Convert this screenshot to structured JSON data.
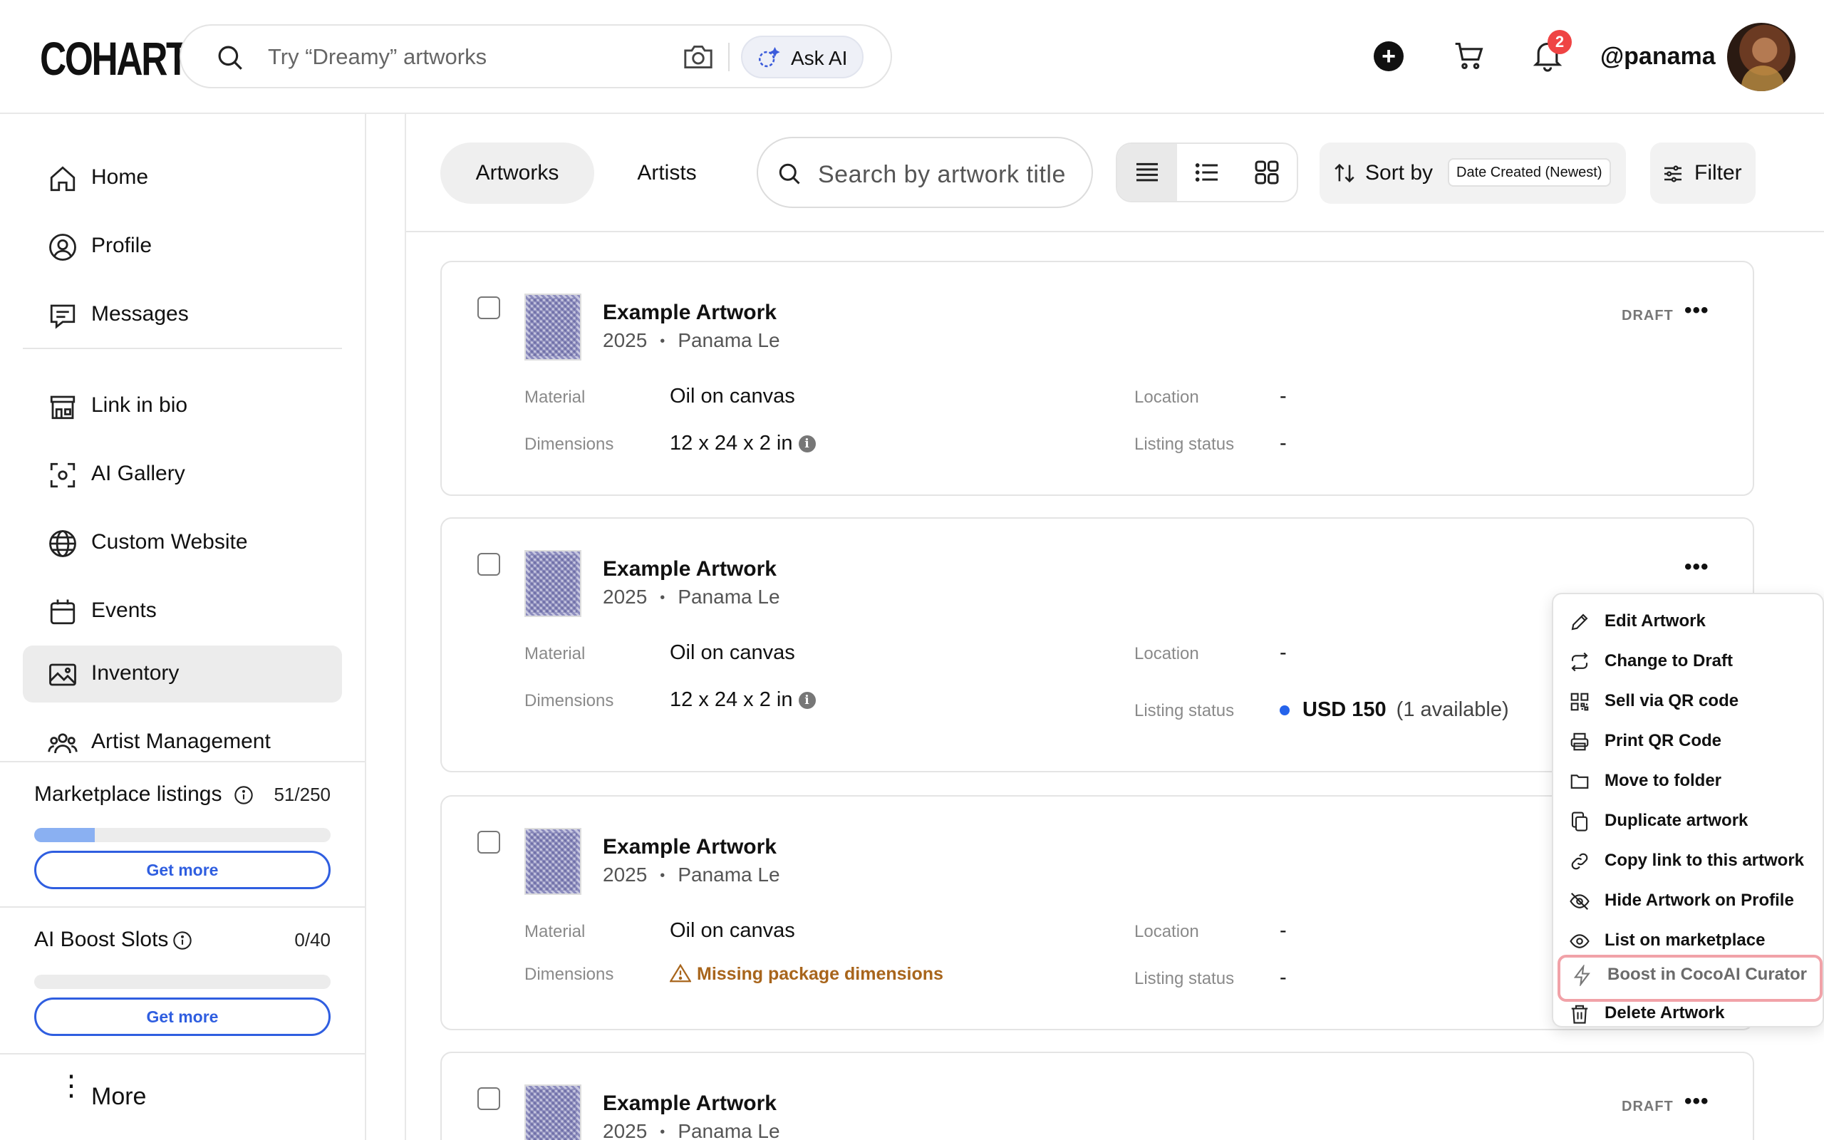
{
  "app": {
    "logo": "COHART",
    "search_placeholder": "Try “Dreamy” artworks",
    "ask_ai": "Ask AI",
    "notifications_count": "2",
    "username": "@panama"
  },
  "sidebar": {
    "items": [
      {
        "label": "Home",
        "icon": "home-icon"
      },
      {
        "label": "Profile",
        "icon": "profile-icon"
      },
      {
        "label": "Messages",
        "icon": "messages-icon"
      },
      {
        "label": "Link in bio",
        "icon": "storefront-icon"
      },
      {
        "label": "AI Gallery",
        "icon": "scan-icon"
      },
      {
        "label": "Custom Website",
        "icon": "globe-icon"
      },
      {
        "label": "Events",
        "icon": "calendar-icon"
      },
      {
        "label": "Inventory",
        "icon": "image-icon",
        "active": true
      },
      {
        "label": "Artist Management",
        "icon": "people-icon"
      }
    ],
    "marketplace": {
      "title": "Marketplace listings",
      "count": "51/250",
      "fraction": 0.204,
      "button": "Get more"
    },
    "boost": {
      "title": "AI Boost Slots",
      "count": "0/40",
      "fraction": 0,
      "button": "Get more"
    },
    "more": "More"
  },
  "toolbar": {
    "tabs": [
      "Artworks",
      "Artists"
    ],
    "search_placeholder": "Search by artwork title",
    "sort_label": "Sort by",
    "sort_value": "Date Created (Newest)",
    "filter": "Filter"
  },
  "labels": {
    "material": "Material",
    "dimensions": "Dimensions",
    "location": "Location",
    "listing_status": "Listing status"
  },
  "artworks": [
    {
      "title": "Example Artwork",
      "year": "2025",
      "artist": "Panama Le",
      "badge": "DRAFT",
      "material": "Oil on canvas",
      "dimensions": "12 x 24 x 2 in",
      "location": "-",
      "listing_status": "-"
    },
    {
      "title": "Example Artwork",
      "year": "2025",
      "artist": "Panama Le",
      "badge": "",
      "material": "Oil on canvas",
      "dimensions": "12 x 24 x 2 in",
      "location": "-",
      "price": "USD 150",
      "availability": "(1 available)"
    },
    {
      "title": "Example Artwork",
      "year": "2025",
      "artist": "Panama Le",
      "badge": "",
      "material": "Oil on canvas",
      "dimensions_warning": "Missing package dimensions",
      "location": "-",
      "listing_status": "-"
    },
    {
      "title": "Example Artwork",
      "year": "2025",
      "artist": "Panama Le",
      "badge": "DRAFT"
    }
  ],
  "separator": "•",
  "menu": [
    {
      "label": "Edit Artwork",
      "icon": "pencil-icon"
    },
    {
      "label": "Change to Draft",
      "icon": "repeat-icon"
    },
    {
      "label": "Sell via QR code",
      "icon": "qr-code-icon"
    },
    {
      "label": "Print QR Code",
      "icon": "printer-icon"
    },
    {
      "label": "Move to folder",
      "icon": "folder-icon"
    },
    {
      "label": "Duplicate artwork",
      "icon": "duplicate-icon"
    },
    {
      "label": "Copy link to this artwork",
      "icon": "link-icon"
    },
    {
      "label": "Hide Artwork on Profile",
      "icon": "eye-off-icon"
    },
    {
      "label": "List on marketplace",
      "icon": "eye-icon"
    },
    {
      "label": "Boost in CocoAI Curator",
      "icon": "lightning-icon",
      "highlighted": true
    },
    {
      "label": "Delete Artwork",
      "icon": "trash-icon"
    }
  ],
  "colors": {
    "accent": "#2f5ee0",
    "warning": "#a8651c",
    "badge": "#ef4444",
    "highlight_border": "#f1a2a8",
    "progress": "#8ab0f2"
  }
}
